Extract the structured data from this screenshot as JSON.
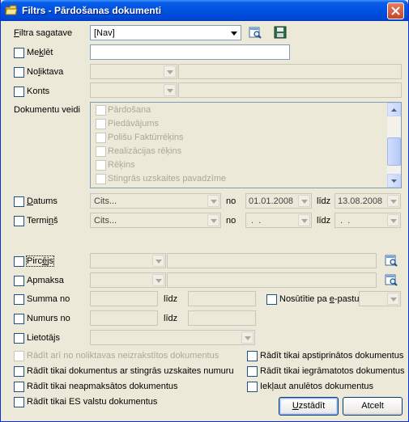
{
  "window": {
    "title": "Filtrs - Pārdošanas dokumenti"
  },
  "colors": {
    "titlebar": "#0054e3",
    "window_bg": "#ece9d8",
    "close_button": "#c6442a",
    "field_border": "#7f9db9",
    "disabled_text": "#aca899"
  },
  "icons": {
    "app": "folder-icon",
    "close": "close-icon",
    "filter_view": "magnifier-icon",
    "filter_save": "floppy-disk-icon",
    "lookup": "magnifier-icon"
  },
  "template": {
    "label_prefix": "F",
    "label_rest": "iltra sagatave",
    "value": "[Nav]"
  },
  "search": {
    "label_pre": "Me",
    "label_u": "k",
    "label_post": "lēt",
    "value": ""
  },
  "warehouse": {
    "label_pre": "No",
    "label_u": "l",
    "label_post": "iktava",
    "value": "",
    "name": ""
  },
  "account": {
    "label_pre": "K",
    "label_u": "o",
    "label_post": "nts",
    "value": "",
    "name": ""
  },
  "doc_types": {
    "label": "Dokumentu veidi",
    "items": [
      {
        "label": "Pārdošana"
      },
      {
        "label": "Piedāvājums"
      },
      {
        "label": "Polišu Faktūrrēķins"
      },
      {
        "label": "Realizācijas rēķins"
      },
      {
        "label": "Rēķins"
      },
      {
        "label": "Stingrās uzskaites pavadzīme"
      }
    ]
  },
  "date": {
    "label_pre": "",
    "label_u": "D",
    "label_post": "atums",
    "period": "Cits...",
    "from_label": "no",
    "from": "01.01.2008",
    "to_label": "līdz",
    "to": "13.08.2008"
  },
  "term": {
    "label_pre": "Termi",
    "label_u": "ņ",
    "label_post": "š",
    "period": "Cits...",
    "from_label": "no",
    "from": " .  .",
    "to_label": "līdz",
    "to": " .  ."
  },
  "buyer": {
    "label_pre": "Pirc",
    "label_u": "ē",
    "label_post": "js",
    "value": "",
    "name": ""
  },
  "payment": {
    "label": "Apmaksa",
    "value": "",
    "name": ""
  },
  "sum": {
    "label": "Summa no",
    "from": "",
    "to_label": "līdz",
    "to": ""
  },
  "email": {
    "label_pre": "Nosūtītie pa ",
    "label_u": "e",
    "label_post": "-pastu",
    "value": ""
  },
  "number": {
    "label": "Numurs no",
    "from": "",
    "to_label": "līdz",
    "to": ""
  },
  "user": {
    "label": "Lietotājs",
    "value": ""
  },
  "options_left": [
    {
      "label": "Rādīt arī no noliktavas neizrakstītos dokumentus",
      "disabled": true
    },
    {
      "label": "Rādīt tikai dokumentus ar stingrās uzskaites numuru",
      "disabled": false
    },
    {
      "label": "Rādīt tikai neapmaksātos dokumentus",
      "disabled": false
    },
    {
      "label": "Rādīt tikai ES valstu dokumentus",
      "disabled": false
    }
  ],
  "options_right": [
    {
      "label": "Rādīt tikai apstiprinātos dokumentus"
    },
    {
      "label": "Rādīt tikai iegrāmatotos dokumentus"
    },
    {
      "label": "Iekļaut anulētos dokumentus"
    }
  ],
  "buttons": {
    "ok_pre": "",
    "ok_u": "U",
    "ok_post": "zstādīt",
    "cancel": "Atcelt"
  }
}
